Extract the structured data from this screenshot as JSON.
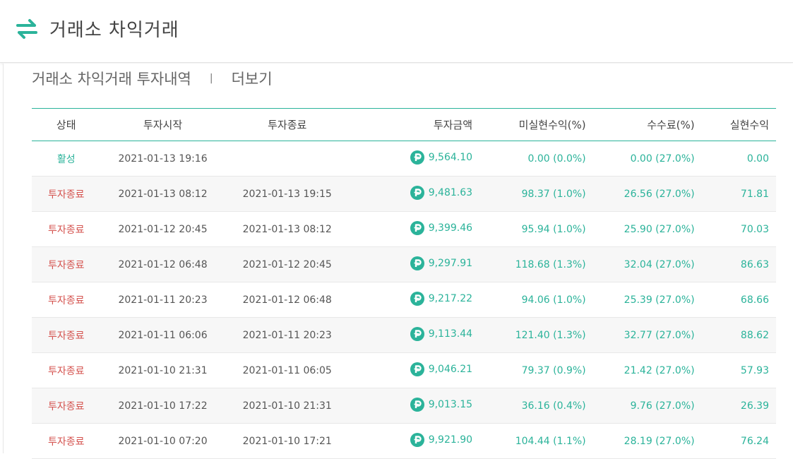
{
  "header": {
    "title": "거래소 차익거래"
  },
  "subheader": {
    "title": "거래소 차익거래 투자내역",
    "separator": "|",
    "more": "더보기"
  },
  "colors": {
    "accent": "#2bb39a",
    "closed": "#d4524e"
  },
  "icons": {
    "logo": "swap-arrows-icon",
    "coin": "point-coin-icon"
  },
  "table": {
    "headers": [
      "상태",
      "투자시작",
      "투자종료",
      "투자금액",
      "미실현수익(%)",
      "수수료(%)",
      "실현수익"
    ],
    "rows": [
      {
        "status": "활성",
        "start": "2021-01-13 19:16",
        "end": "",
        "amount": "9,564.10",
        "unrealized": "0.00 (0.0%)",
        "fee": "0.00 (27.0%)",
        "realized": "0.00"
      },
      {
        "status": "투자종료",
        "start": "2021-01-13 08:12",
        "end": "2021-01-13 19:15",
        "amount": "9,481.63",
        "unrealized": "98.37 (1.0%)",
        "fee": "26.56 (27.0%)",
        "realized": "71.81"
      },
      {
        "status": "투자종료",
        "start": "2021-01-12 20:45",
        "end": "2021-01-13 08:12",
        "amount": "9,399.46",
        "unrealized": "95.94 (1.0%)",
        "fee": "25.90 (27.0%)",
        "realized": "70.03"
      },
      {
        "status": "투자종료",
        "start": "2021-01-12 06:48",
        "end": "2021-01-12 20:45",
        "amount": "9,297.91",
        "unrealized": "118.68 (1.3%)",
        "fee": "32.04 (27.0%)",
        "realized": "86.63"
      },
      {
        "status": "투자종료",
        "start": "2021-01-11 20:23",
        "end": "2021-01-12 06:48",
        "amount": "9,217.22",
        "unrealized": "94.06 (1.0%)",
        "fee": "25.39 (27.0%)",
        "realized": "68.66"
      },
      {
        "status": "투자종료",
        "start": "2021-01-11 06:06",
        "end": "2021-01-11 20:23",
        "amount": "9,113.44",
        "unrealized": "121.40 (1.3%)",
        "fee": "32.77 (27.0%)",
        "realized": "88.62"
      },
      {
        "status": "투자종료",
        "start": "2021-01-10 21:31",
        "end": "2021-01-11 06:05",
        "amount": "9,046.21",
        "unrealized": "79.37 (0.9%)",
        "fee": "21.42 (27.0%)",
        "realized": "57.93"
      },
      {
        "status": "투자종료",
        "start": "2021-01-10 17:22",
        "end": "2021-01-10 21:31",
        "amount": "9,013.15",
        "unrealized": "36.16 (0.4%)",
        "fee": "9.76 (27.0%)",
        "realized": "26.39"
      },
      {
        "status": "투자종료",
        "start": "2021-01-10 07:20",
        "end": "2021-01-10 17:21",
        "amount": "9,921.90",
        "unrealized": "104.44 (1.1%)",
        "fee": "28.19 (27.0%)",
        "realized": "76.24"
      }
    ]
  }
}
